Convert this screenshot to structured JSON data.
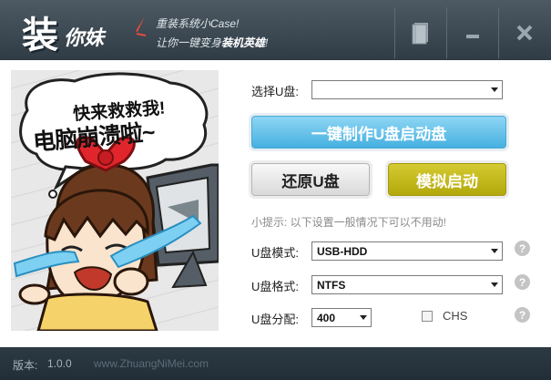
{
  "titlebar": {
    "logo_main": "装",
    "logo_sub": "你妹",
    "slogan_line1": "重装系统小Case!",
    "slogan_line2_prefix": "让你一键变身",
    "slogan_line2_bold": "装机英雄",
    "slogan_line2_suffix": "!",
    "icons": [
      "book-icon",
      "minimize-icon",
      "close-icon"
    ]
  },
  "illustration": {
    "bubble_line1": "快来救救我!",
    "bubble_line2": "电脑崩溃啦~"
  },
  "form": {
    "select_drive_label": "选择U盘:",
    "select_drive_value": "",
    "make_button": "一键制作U盘启动盘",
    "restore_button": "还原U盘",
    "simulate_button": "模拟启动",
    "tip": "小提示: 以下设置一般情况下可以不用动!",
    "mode_label": "U盘模式:",
    "mode_value": "USB-HDD",
    "format_label": "U盘格式:",
    "format_value": "NTFS",
    "partition_label": "U盘分配:",
    "partition_value": "400",
    "chs_label": "CHS",
    "chs_checked": false,
    "help_glyph": "?"
  },
  "footer": {
    "version_label": "版本:",
    "version_value": "1.0.0",
    "website": "www.ZhuangNiMei.com"
  },
  "colors": {
    "titlebar": "#3a4751",
    "make_button": "#45b0e0",
    "simulate_button": "#b3a80b",
    "footer": "#26323b"
  }
}
